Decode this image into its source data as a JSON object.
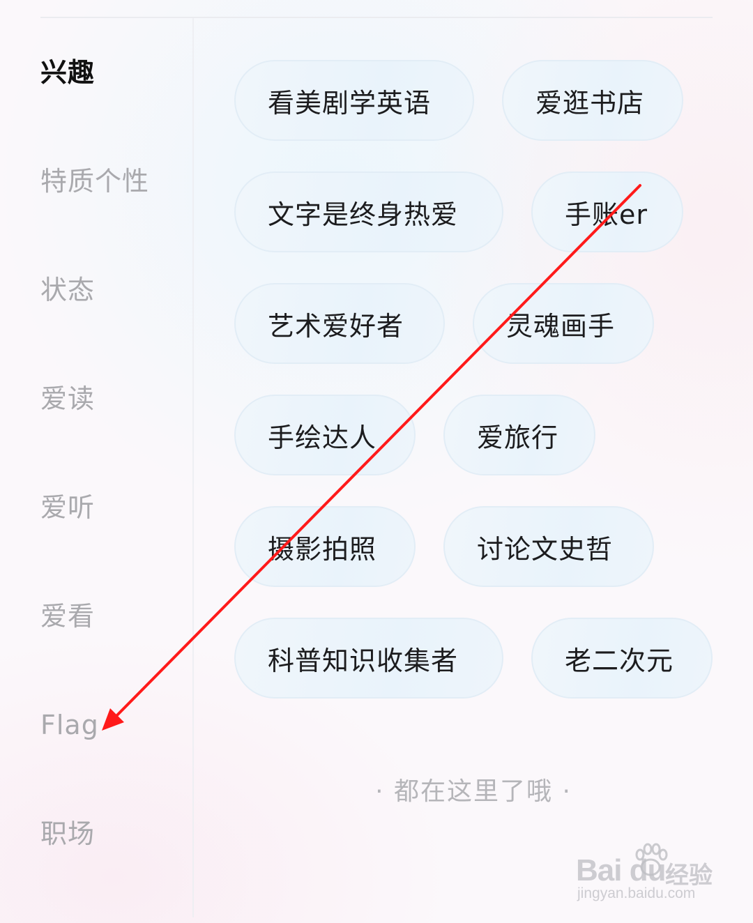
{
  "sidebar": {
    "items": [
      {
        "label": "兴趣",
        "active": true
      },
      {
        "label": "特质个性",
        "active": false
      },
      {
        "label": "状态",
        "active": false
      },
      {
        "label": "爱读",
        "active": false
      },
      {
        "label": "爱听",
        "active": false
      },
      {
        "label": "爱看",
        "active": false
      },
      {
        "label": "Flag",
        "active": false
      },
      {
        "label": "职场",
        "active": false
      }
    ]
  },
  "tags": [
    "看美剧学英语",
    "爱逛书店",
    "文字是终身热爱",
    "手账er",
    "艺术爱好者",
    "灵魂画手",
    "手绘达人",
    "爱旅行",
    "摄影拍照",
    "讨论文史哲",
    "科普知识收集者",
    "老二次元"
  ],
  "footer_note": "· 都在这里了哦 ·",
  "annotation": {
    "color": "#ff1a1a"
  },
  "watermark": {
    "logo": "Bai du",
    "cn": "经验",
    "url": "jingyan.baidu.com"
  }
}
